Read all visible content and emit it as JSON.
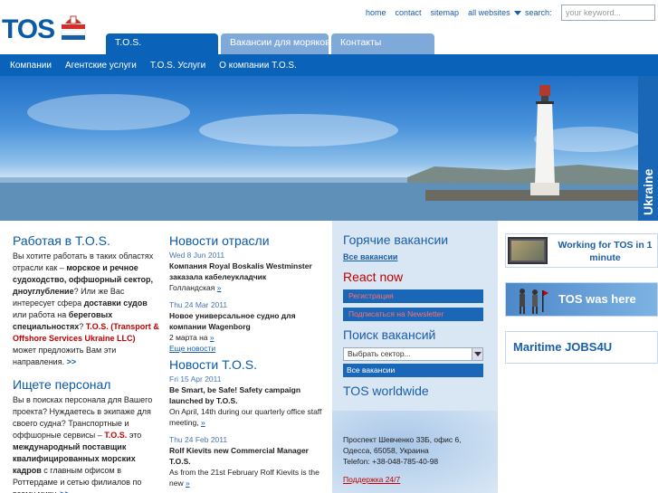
{
  "header": {
    "logo_text": "TOS",
    "links": [
      "home",
      "contact",
      "sitemap",
      "all websites"
    ],
    "search_label": "search:",
    "search_placeholder": "your keyword..."
  },
  "tabs": [
    {
      "label": "T.O.S."
    },
    {
      "label": "Вакансии для моряков"
    },
    {
      "label": "Контакты"
    }
  ],
  "nav": [
    "Компании",
    "Агентские услуги",
    "T.O.S. Услуги",
    "О компании T.O.S."
  ],
  "banner": {
    "side_label": "Ukraine"
  },
  "col1": {
    "h1": "Работая в T.O.S.",
    "p1_a": "Вы хотите работать в таких областях отрасли как – ",
    "p1_b": "морское и речное судоходство, оффшорный сектор, дноуглубление",
    "p1_c": "? Или же Вас интересует сфера ",
    "p1_d": "доставки судов",
    "p1_e": " или работа на ",
    "p1_f": "береговых специальностях",
    "p1_g": "? ",
    "p1_h": "T.O.S. (Transport & Offshore Services Ukraine LLC)",
    "p1_i": " может предложить Вам эти направления. ",
    "more": ">>",
    "h2": "Ищете персонал",
    "p2_a": "Вы в поисках персонала для Вашего проекта? Нуждаетесь в экипаже для своего судна? Транспортные и оффшорные сервисы – ",
    "p2_b": "T.O.S.",
    "p2_c": " это ",
    "p2_d": "международный поставщик квалифицированных морских кадров",
    "p2_e": " с главным офисом в Роттердаме и сетью филиалов по всему миру. "
  },
  "col2": {
    "h1": "Новости отрасли",
    "news1": [
      {
        "date": "Wed 8 Jun 2011",
        "title": "Компания Royal Boskalis Westminster заказала кабелеукладчик",
        "text": "Голландская ",
        "link": "»"
      },
      {
        "date": "Thu 24 Mar 2011",
        "title": "Новое универсальное судно для компании Wagenborg",
        "text": "2 марта на ",
        "link": "»"
      }
    ],
    "more_news": "Еще новости",
    "h2": "Новости T.O.S.",
    "news2": [
      {
        "date": "Fri 15 Apr 2011",
        "title": "Be Smart, be Safe! Safety campaign launched by T.O.S.",
        "text": "On April, 14th during our quarterly office staff meeting, ",
        "link": "»"
      },
      {
        "date": "Thu 24 Feb 2011",
        "title": "Rolf Kievits new Commercial Manager T.O.S.",
        "text": "As from the 21st February Rolf Kievits is the new ",
        "link": "»"
      }
    ]
  },
  "col3": {
    "h_hot": "Горячие вакансии",
    "all_vacancies": "Все вакансии",
    "h_react": "React now",
    "register": "Регистрация",
    "newsletter": "Подписаться на Newsletter",
    "h_search": "Поиск вакансий",
    "select_value": "Выбрать сектор...",
    "all_vacancies_btn": "Все вакансии",
    "h_world": "TOS worldwide",
    "address_1": "Проспект Шевченко 33Б, офис 6,",
    "address_2": "Одесса, 65058, Украина",
    "phone": "Telefon: +38-048-785-40-98",
    "support": "Поддержка 24/7"
  },
  "col4": {
    "promo1": "Working for TOS in 1 minute",
    "promo2": "TOS was here",
    "promo3": "Maritime JOBS4U"
  },
  "colors": {
    "brand_blue": "#0a63b8",
    "accent_red": "#c00000",
    "sidebar_bg": "#d9e7f5"
  }
}
